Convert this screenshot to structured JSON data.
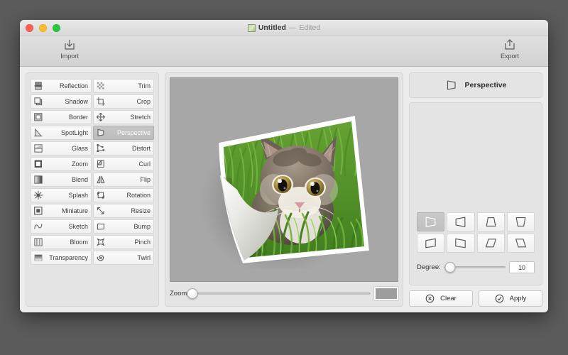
{
  "desktop": {
    "background": "#5b5b5b"
  },
  "window": {
    "title": {
      "name": "Untitled",
      "dash": "—",
      "state": "Edited",
      "doc_icon": "image-document-icon"
    },
    "traffic_lights": [
      {
        "name": "close-button",
        "color": "#ff5f57"
      },
      {
        "name": "minimize-button",
        "color": "#febc2e"
      },
      {
        "name": "zoom-button",
        "color": "#28c840"
      }
    ]
  },
  "toolbar": {
    "import_label": "Import",
    "import_icon": "import-tray-down-icon",
    "export_label": "Export",
    "export_icon": "export-share-up-icon"
  },
  "effects": {
    "selected": "Perspective",
    "items": [
      {
        "label": "Reflection",
        "icon": "reflection-icon"
      },
      {
        "label": "Trim",
        "icon": "trim-checker-icon"
      },
      {
        "label": "Shadow",
        "icon": "shadow-squares-icon"
      },
      {
        "label": "Crop",
        "icon": "crop-icon"
      },
      {
        "label": "Border",
        "icon": "border-frame-icon"
      },
      {
        "label": "Stretch",
        "icon": "stretch-arrows-icon"
      },
      {
        "label": "SpotLight",
        "icon": "spotlight-cone-icon"
      },
      {
        "label": "Perspective",
        "icon": "perspective-trapezoid-icon"
      },
      {
        "label": "Glass",
        "icon": "glass-split-icon"
      },
      {
        "label": "Distort",
        "icon": "distort-nodes-icon"
      },
      {
        "label": "Zoom",
        "icon": "zoom-square-icon"
      },
      {
        "label": "Curl",
        "icon": "curl-page-icon"
      },
      {
        "label": "Blend",
        "icon": "blend-gradient-icon"
      },
      {
        "label": "Flip",
        "icon": "flip-mirror-icon"
      },
      {
        "label": "Splash",
        "icon": "splash-star-icon"
      },
      {
        "label": "Rotation",
        "icon": "rotation-arrows-icon"
      },
      {
        "label": "Miniature",
        "icon": "miniature-square-icon"
      },
      {
        "label": "Resize",
        "icon": "resize-diagonal-arrow-icon"
      },
      {
        "label": "Sketch",
        "icon": "sketch-wave-icon"
      },
      {
        "label": "Bump",
        "icon": "bump-flag-icon"
      },
      {
        "label": "Bloom",
        "icon": "bloom-bars-icon"
      },
      {
        "label": "Pinch",
        "icon": "pinch-concave-icon"
      },
      {
        "label": "Transparency",
        "icon": "transparency-fade-icon"
      },
      {
        "label": "Twirl",
        "icon": "twirl-spiral-icon"
      }
    ]
  },
  "canvas": {
    "image_subject": "kitten in grass with page curl effect",
    "background_color": "#a7a7a7",
    "zoom_label": "Zoom:",
    "zoom_value": 0,
    "fit_button": "fit-to-window-button"
  },
  "inspector": {
    "title": "Perspective",
    "title_icon": "perspective-trapezoid-icon",
    "perspective_modes": [
      {
        "name": "perspective-left",
        "icon": "trapezoid-left-icon",
        "selected": true
      },
      {
        "name": "perspective-right",
        "icon": "trapezoid-right-icon",
        "selected": false
      },
      {
        "name": "perspective-top",
        "icon": "trapezoid-top-icon",
        "selected": false
      },
      {
        "name": "perspective-bottom",
        "icon": "trapezoid-bottom-icon",
        "selected": false
      },
      {
        "name": "perspective-skew-up-left",
        "icon": "parallelogram-up-left-icon",
        "selected": false
      },
      {
        "name": "perspective-skew-up-right",
        "icon": "parallelogram-up-right-icon",
        "selected": false
      },
      {
        "name": "perspective-skew-right",
        "icon": "parallelogram-right-icon",
        "selected": false
      },
      {
        "name": "perspective-skew-left",
        "icon": "parallelogram-left-icon",
        "selected": false
      }
    ],
    "degree_label": "Degree:",
    "degree_value": "10",
    "degree_percent": 10,
    "clear_label": "Clear",
    "clear_icon": "circle-x-icon",
    "apply_label": "Apply",
    "apply_icon": "circle-check-icon"
  }
}
